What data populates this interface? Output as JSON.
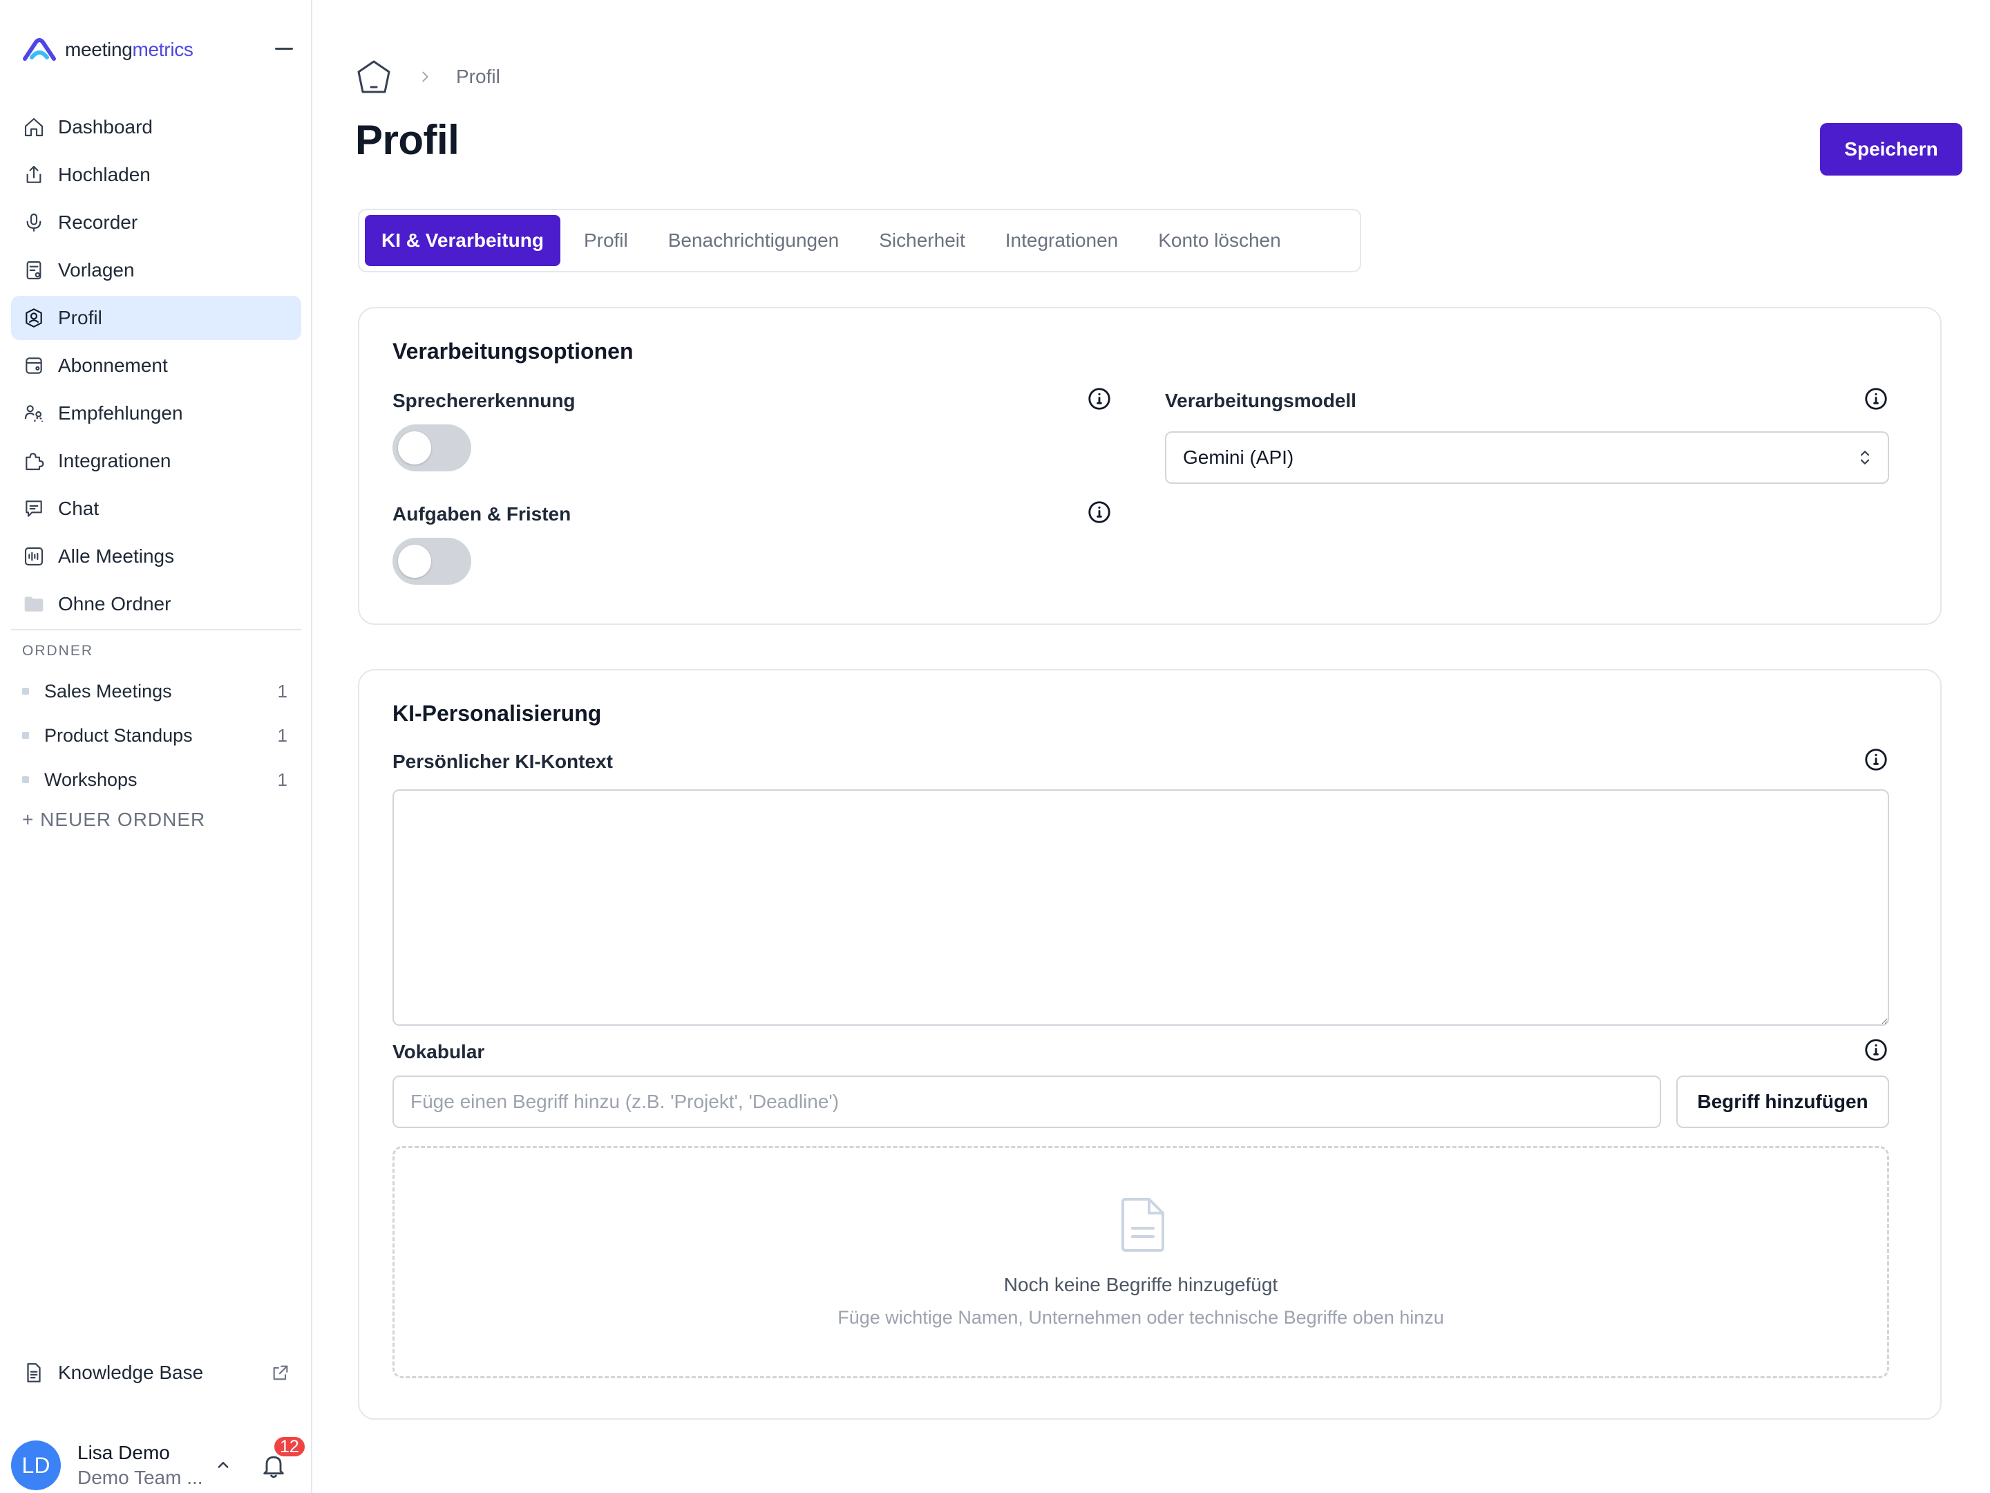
{
  "brand": {
    "name_part1": "meeting",
    "name_part2": "metrics",
    "accent_color": "#4f46e5",
    "primary_button_color": "#4c1dcc"
  },
  "sidebar": {
    "nav": [
      {
        "label": "Dashboard",
        "icon": "home-icon"
      },
      {
        "label": "Hochladen",
        "icon": "upload-icon"
      },
      {
        "label": "Recorder",
        "icon": "microphone-icon"
      },
      {
        "label": "Vorlagen",
        "icon": "template-icon"
      },
      {
        "label": "Profil",
        "icon": "profile-icon",
        "active": true
      },
      {
        "label": "Abonnement",
        "icon": "subscription-icon"
      },
      {
        "label": "Empfehlungen",
        "icon": "referral-icon"
      },
      {
        "label": "Integrationen",
        "icon": "puzzle-icon"
      },
      {
        "label": "Chat",
        "icon": "chat-icon"
      },
      {
        "label": "Alle Meetings",
        "icon": "audio-wave-icon"
      },
      {
        "label": "Ohne Ordner",
        "icon": "folder-icon"
      }
    ],
    "folders_title": "ORDNER",
    "folders": [
      {
        "label": "Sales Meetings",
        "count": "1"
      },
      {
        "label": "Product Standups",
        "count": "1"
      },
      {
        "label": "Workshops",
        "count": "1"
      }
    ],
    "new_folder": "+ NEUER ORDNER",
    "knowledge_base": "Knowledge Base",
    "user": {
      "initials": "LD",
      "name": "Lisa Demo",
      "team": "Demo Team ...",
      "notification_count": "12"
    }
  },
  "header": {
    "breadcrumb": "Profil",
    "title": "Profil",
    "save_label": "Speichern"
  },
  "tabs": [
    {
      "label": "KI & Verarbeitung",
      "active": true
    },
    {
      "label": "Profil"
    },
    {
      "label": "Benachrichtigungen"
    },
    {
      "label": "Sicherheit"
    },
    {
      "label": "Integrationen"
    },
    {
      "label": "Konto löschen"
    }
  ],
  "processing": {
    "title": "Verarbeitungsoptionen",
    "speaker_label": "Sprechererkennung",
    "speaker_enabled": false,
    "tasks_label": "Aufgaben & Fristen",
    "tasks_enabled": false,
    "model_label": "Verarbeitungsmodell",
    "model_value": "Gemini (API)"
  },
  "personalization": {
    "title": "KI-Personalisierung",
    "context_label": "Persönlicher KI-Kontext",
    "context_value": "",
    "vocab_label": "Vokabular",
    "vocab_placeholder": "Füge einen Begriff hinzu (z.B. 'Projekt', 'Deadline')",
    "add_label": "Begriff hinzufügen",
    "empty_title": "Noch keine Begriffe hinzugefügt",
    "empty_subtitle": "Füge wichtige Namen, Unternehmen oder technische Begriffe oben hinzu"
  }
}
